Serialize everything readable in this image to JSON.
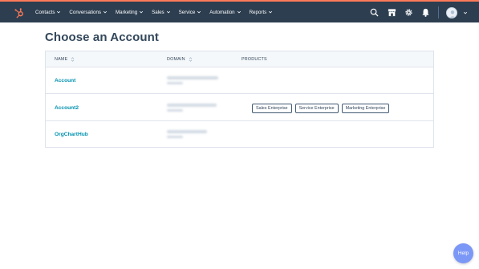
{
  "nav": {
    "items": [
      {
        "label": "Contacts"
      },
      {
        "label": "Conversations"
      },
      {
        "label": "Marketing"
      },
      {
        "label": "Sales"
      },
      {
        "label": "Service"
      },
      {
        "label": "Automation"
      },
      {
        "label": "Reports"
      }
    ],
    "icons": [
      "search-icon",
      "marketplace-icon",
      "settings-icon",
      "notifications-icon"
    ]
  },
  "page": {
    "title": "Choose an Account"
  },
  "table": {
    "columns": {
      "name": "NAME",
      "domain": "DOMAIN",
      "products": "PRODUCTS"
    },
    "rows": [
      {
        "name": "Account",
        "products": []
      },
      {
        "name": "Account2",
        "products": [
          "Sales Enterprise",
          "Service Enterprise",
          "Marketing Enterprise"
        ]
      },
      {
        "name": "OrgChartHub",
        "products": []
      }
    ]
  },
  "help": {
    "label": "Help"
  },
  "colors": {
    "topbar": "#2d3e50",
    "accent": "#ff7a59",
    "link": "#0091ae",
    "help": "#7c98f7"
  }
}
